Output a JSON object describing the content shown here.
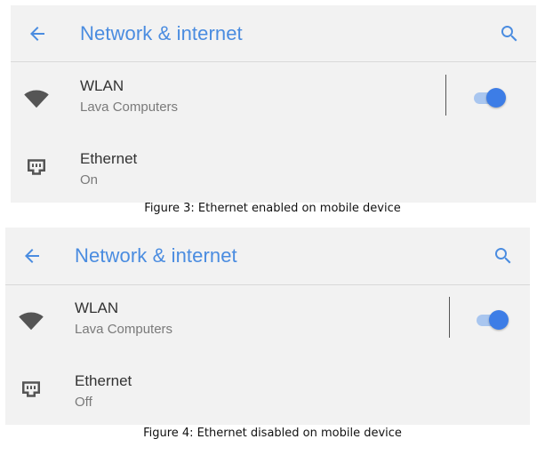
{
  "screens": [
    {
      "app_bar": {
        "title": "Network & internet",
        "back_icon": "arrow-back-icon",
        "search_icon": "search-icon"
      },
      "wlan": {
        "title": "WLAN",
        "subtitle": "Lava Computers",
        "icon": "wifi-icon",
        "toggle_on": true
      },
      "ethernet": {
        "title": "Ethernet",
        "status": "On",
        "icon": "ethernet-icon"
      },
      "caption": "Figure 3: Ethernet enabled on mobile device"
    },
    {
      "app_bar": {
        "title": "Network & internet",
        "back_icon": "arrow-back-icon",
        "search_icon": "search-icon"
      },
      "wlan": {
        "title": "WLAN",
        "subtitle": "Lava Computers",
        "icon": "wifi-icon",
        "toggle_on": true
      },
      "ethernet": {
        "title": "Ethernet",
        "status": "Off",
        "icon": "ethernet-icon"
      },
      "caption": "Figure 4: Ethernet disabled on mobile device"
    }
  ],
  "colors": {
    "accent": "#4a8ce0",
    "toggle_thumb": "#3d7de6",
    "toggle_track": "#a9c6ef",
    "panel_bg": "#f2f2f2",
    "icon": "#555555"
  }
}
